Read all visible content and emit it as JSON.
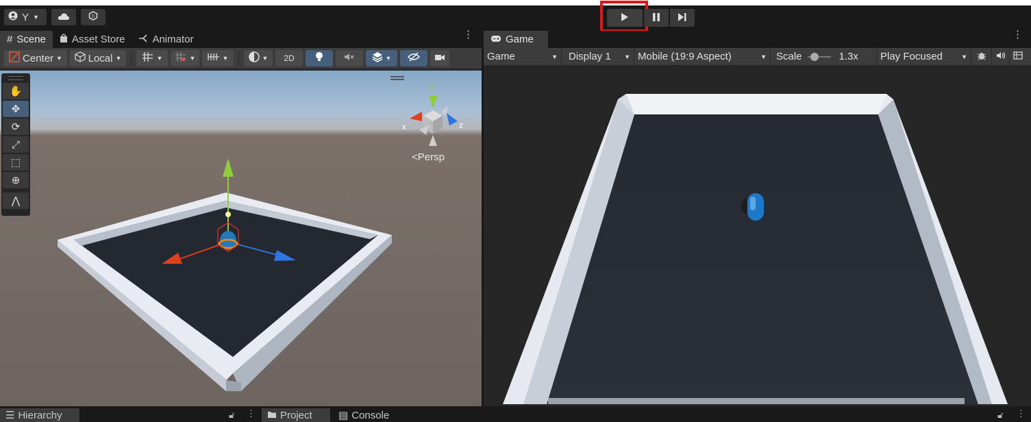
{
  "toolbar": {
    "account_label": "Y",
    "play_icon": "play-icon",
    "pause_icon": "pause-icon",
    "step_icon": "step-icon",
    "highlight_color": "#e0161b"
  },
  "scene_panel": {
    "tabs": [
      {
        "label": "Scene",
        "icon": "grid-icon"
      },
      {
        "label": "Asset Store",
        "icon": "bag-icon"
      },
      {
        "label": "Animator",
        "icon": "animator-icon"
      }
    ],
    "pivot_label": "Center",
    "space_label": "Local",
    "mode_2d_label": "2D",
    "persp_label": "Persp",
    "gizmo_axes": {
      "x": "x",
      "y": "y",
      "z": "z"
    },
    "tools": [
      "hand-tool",
      "move-tool",
      "rotate-tool",
      "scale-tool",
      "rect-tool",
      "transform-tool",
      "custom-tool"
    ]
  },
  "game_panel": {
    "tab_label": "Game",
    "view_select": "Game",
    "display_select": "Display 1",
    "aspect_select": "Mobile (19:9 Aspect)",
    "scale_label": "Scale",
    "scale_value": "1.3x",
    "play_mode_select": "Play Focused"
  },
  "bottom": {
    "hierarchy_label": "Hierarchy",
    "project_label": "Project",
    "console_label": "Console"
  },
  "colors": {
    "accent_blue": "#46607c",
    "panel_bg": "#282828",
    "toolbar_bg": "#3c3c3c"
  }
}
